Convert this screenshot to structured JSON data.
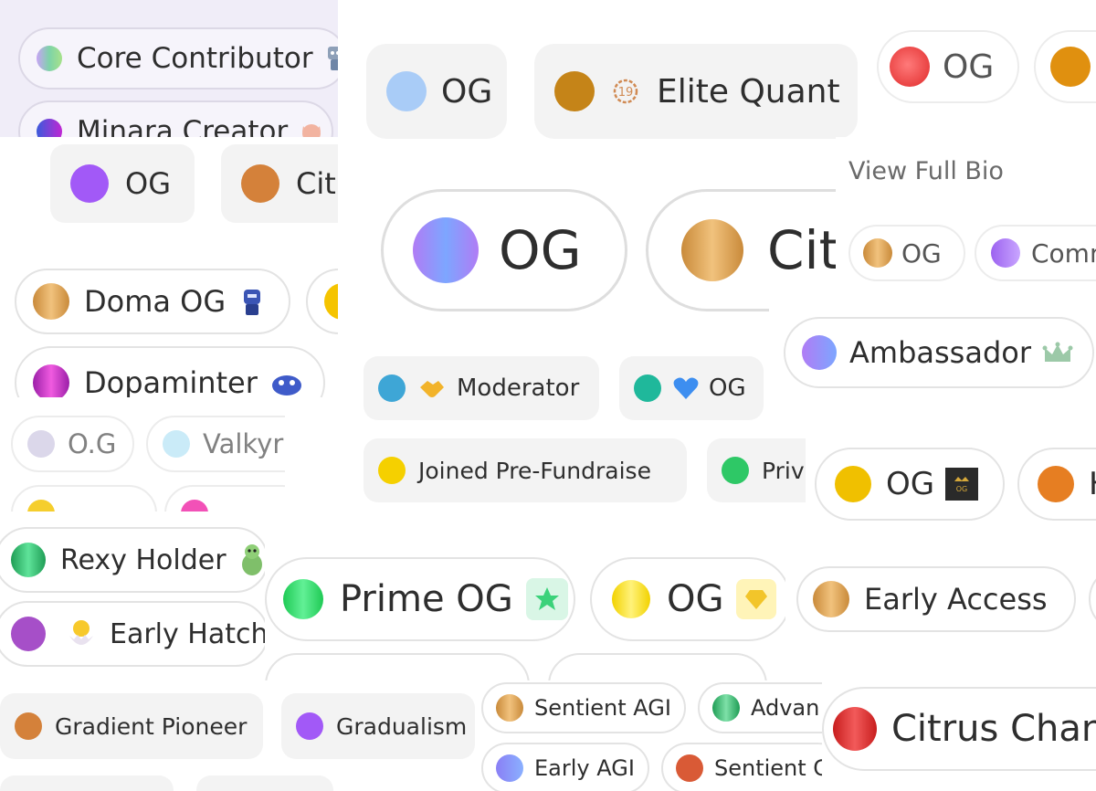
{
  "colors": {
    "rainbow": "#7ed3a8",
    "purple": "#a259f7",
    "orange": "#d4813a",
    "gold": "#e2a959",
    "magenta": "#d12bbd",
    "green": "#2ec866",
    "yellow": "#f5d000",
    "red": "#e03232",
    "blue_gradient": "#8aa0ff",
    "teal": "#1fb89b",
    "sky": "#3ea6d6"
  },
  "badges": {
    "core_contributor": "Core Contributor",
    "minara_creator": "Minara Creator",
    "og": "OG",
    "cit_partial": "Cit",
    "doma_og": "Doma OG",
    "dopaminter": "Dopaminter",
    "og_dotted": "O.G",
    "valkyr_partial": "Valkyr",
    "elite_quant": "Elite Quant",
    "moderator": "Moderator",
    "joined_prefundraise": "Joined Pre-Fundraise",
    "priv_partial": "Priv",
    "rexy_holder": "Rexy Holder",
    "early_hatch": "Early Hatch",
    "prime_og": "Prime OG",
    "gradient_pioneer": "Gradient Pioneer",
    "gradualism": "Gradualism",
    "sentient_agi": "Sentient AGI",
    "advan_partial": "Advan",
    "early_agi": "Early AGI",
    "sentient_partial": "Sentient C",
    "comm_partial": "Comm",
    "ambassador": "Ambassador",
    "early_access": "Early Access",
    "citrus_partial": "Citrus Chan",
    "h_partial": "H"
  },
  "links": {
    "view_full_bio": "View Full Bio"
  },
  "icons": {
    "elite_quant": "19-gear-icon",
    "moderator": "handshake-icon",
    "og_heart": "blue-heart-icon",
    "ambassador": "crown-icon",
    "rexy": "dinosaur-icon",
    "hatch": "hatching-chick-icon",
    "prime": "star-icon",
    "og_gem": "gem-icon",
    "og_box": "og-logo-icon"
  }
}
